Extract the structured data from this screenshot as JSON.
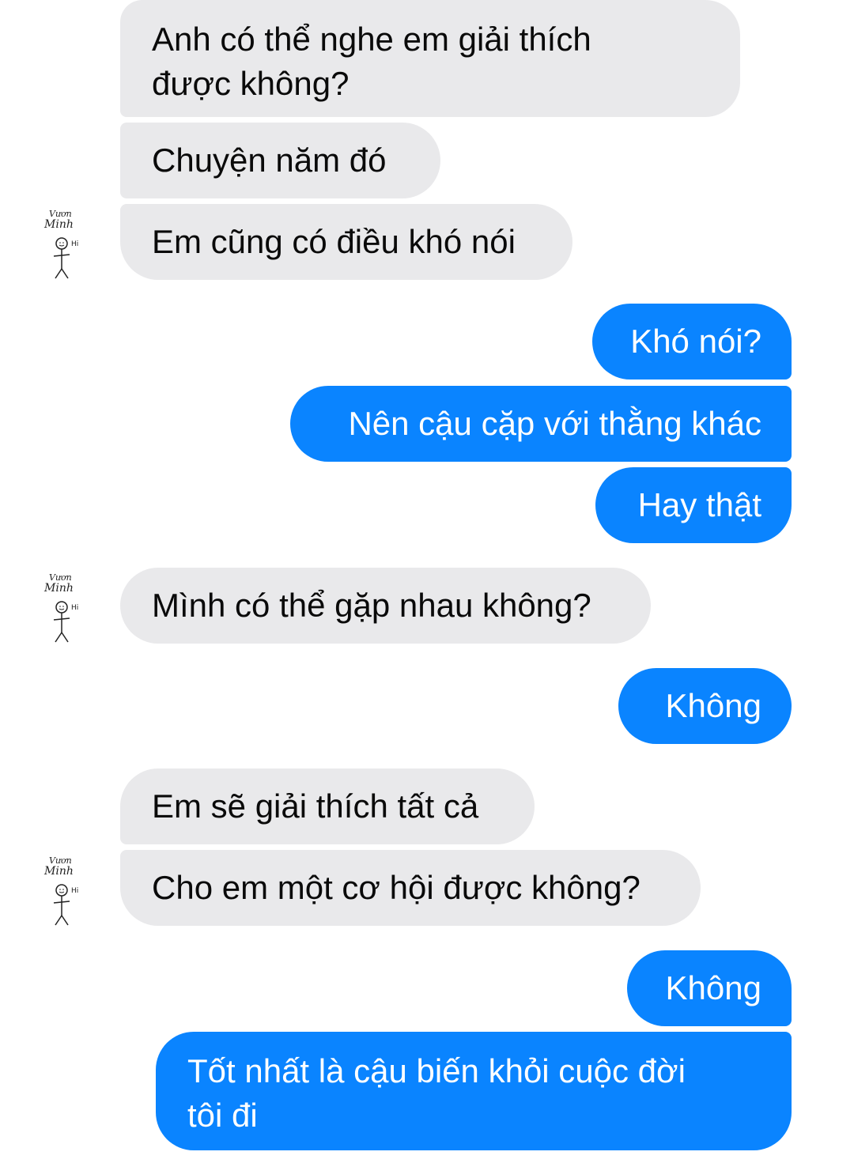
{
  "conversation": {
    "messages": [
      {
        "from": "other",
        "text": "Anh có thể nghe em giải thích\nđược không?"
      },
      {
        "from": "other",
        "text": "Chuyện năm đó"
      },
      {
        "from": "other",
        "text": "Em cũng có điều khó nói"
      },
      {
        "from": "me",
        "text": "Khó nói?"
      },
      {
        "from": "me",
        "text": "Nên cậu cặp với thằng khác"
      },
      {
        "from": "me",
        "text": "Hay thật"
      },
      {
        "from": "other",
        "text": "Mình có thể gặp nhau không?"
      },
      {
        "from": "me",
        "text": "Không"
      },
      {
        "from": "other",
        "text": "Em sẽ giải thích tất cả"
      },
      {
        "from": "other",
        "text": "Cho em một cơ hội được không?"
      },
      {
        "from": "me",
        "text": "Không"
      },
      {
        "from": "me",
        "text": "Tốt nhất là cậu biến khỏi cuộc đời\ntôi đi"
      }
    ]
  },
  "avatar": {
    "icon": "stick-figure-avatar-icon",
    "name_text": "Minh",
    "scribble_text": "Vươn",
    "hi_text": "Hi"
  },
  "colors": {
    "incoming_bubble": "#e9e9eb",
    "outgoing_bubble": "#0a84ff",
    "outgoing_text": "#ffffff"
  }
}
